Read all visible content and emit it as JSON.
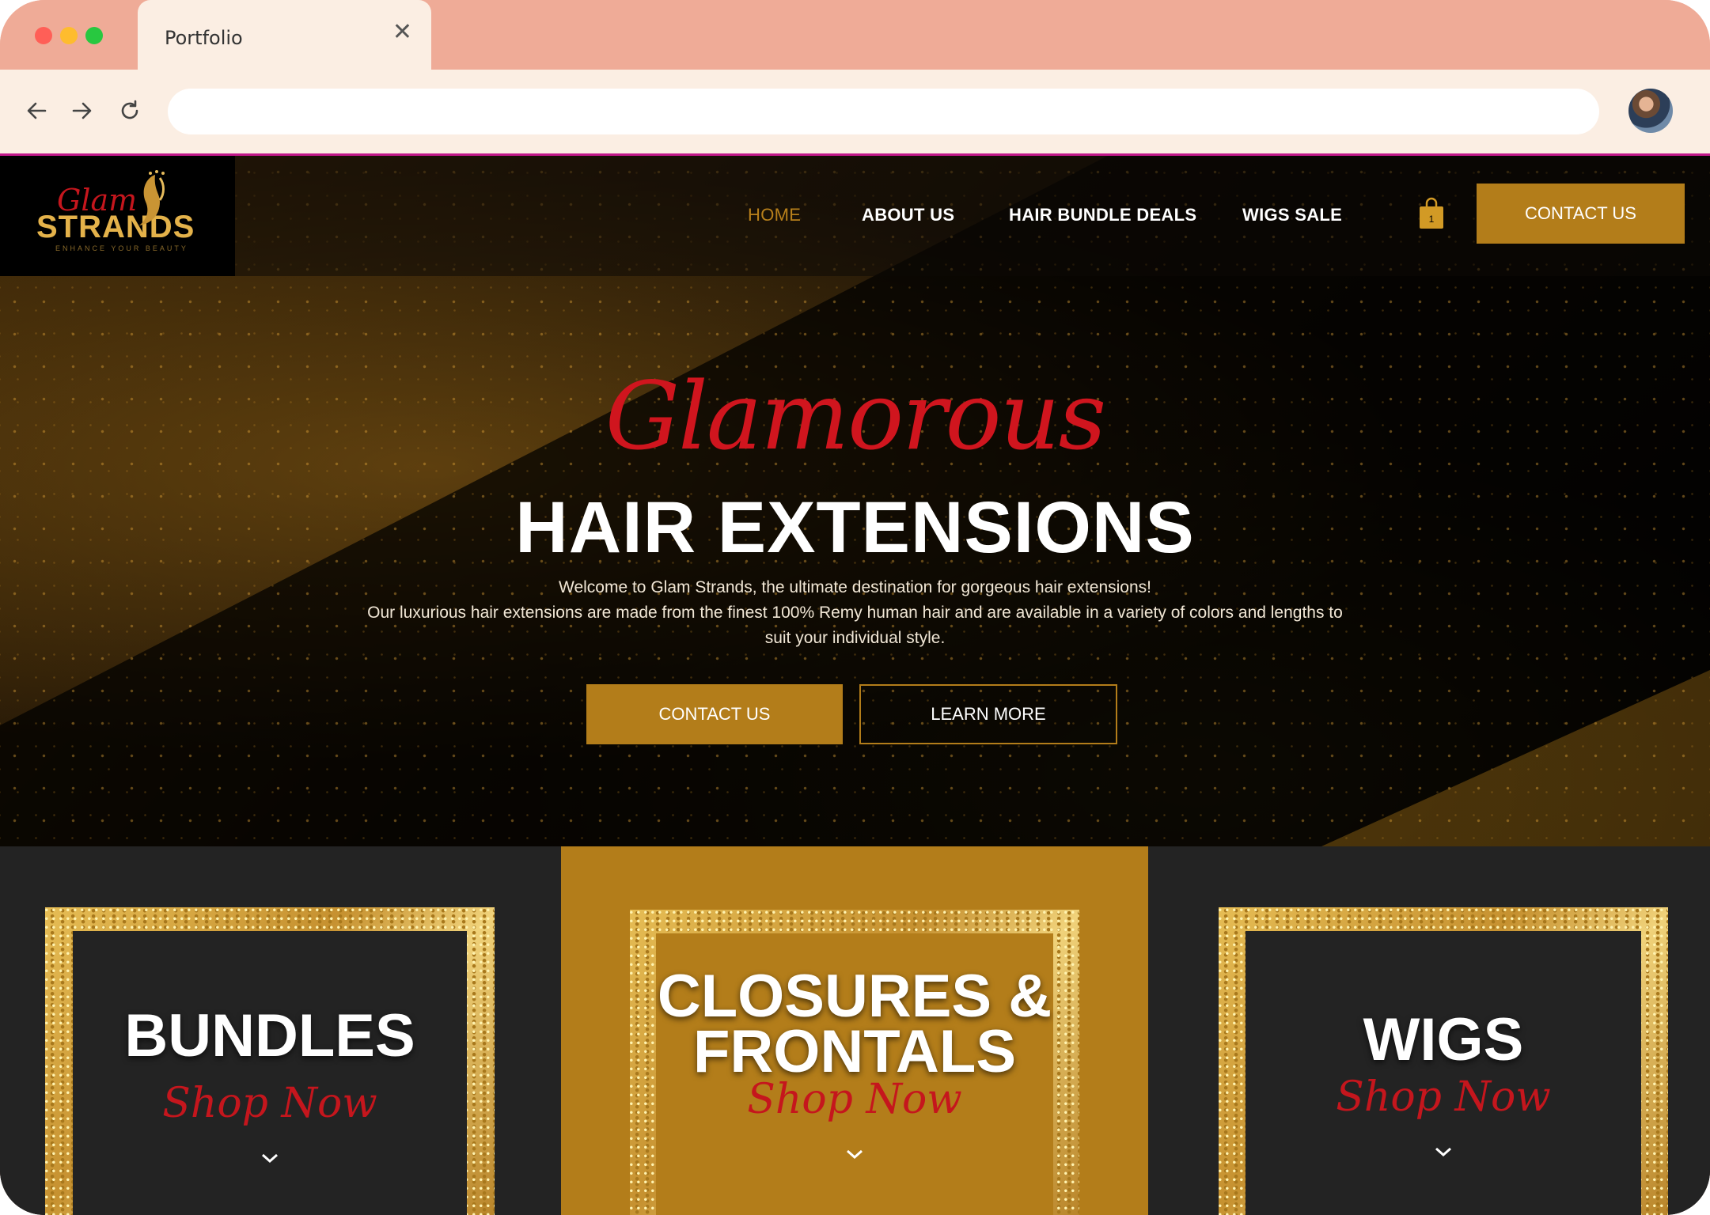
{
  "browser": {
    "tab_title": "Portfolio",
    "url": ""
  },
  "site": {
    "logo": {
      "script": "Glam",
      "main": "STRANDS",
      "tagline": "ENHANCE YOUR BEAUTY"
    },
    "nav": [
      {
        "label": "HOME",
        "active": true
      },
      {
        "label": "ABOUT US",
        "active": false
      },
      {
        "label": "HAIR BUNDLE DEALS",
        "active": false
      },
      {
        "label": "WIGS SALE",
        "active": false
      }
    ],
    "cart_count": "1",
    "contact_button": "CONTACT US",
    "hero": {
      "script": "Glamorous",
      "title": "HAIR EXTENSIONS",
      "text_line1": "Welcome to Glam Strands, the ultimate destination for gorgeous hair extensions!",
      "text_line2": "Our luxurious hair extensions are made from the finest 100% Remy human hair and are available in a variety of colors and lengths to",
      "text_line3": "suit your individual style.",
      "contact_label": "CONTACT US",
      "learn_label": "LEARN MORE"
    },
    "categories": [
      {
        "title_line1": "BUNDLES",
        "title_line2": "",
        "cta": "Shop Now"
      },
      {
        "title_line1": "CLOSURES &",
        "title_line2": "FRONTALS",
        "cta": "Shop Now"
      },
      {
        "title_line1": "WIGS",
        "title_line2": "",
        "cta": "Shop Now"
      }
    ]
  },
  "colors": {
    "chrome": "#efab97",
    "toolbar": "#fbeee3",
    "gold": "#b37d1a",
    "red": "#c5161d",
    "dark": "#232323"
  }
}
